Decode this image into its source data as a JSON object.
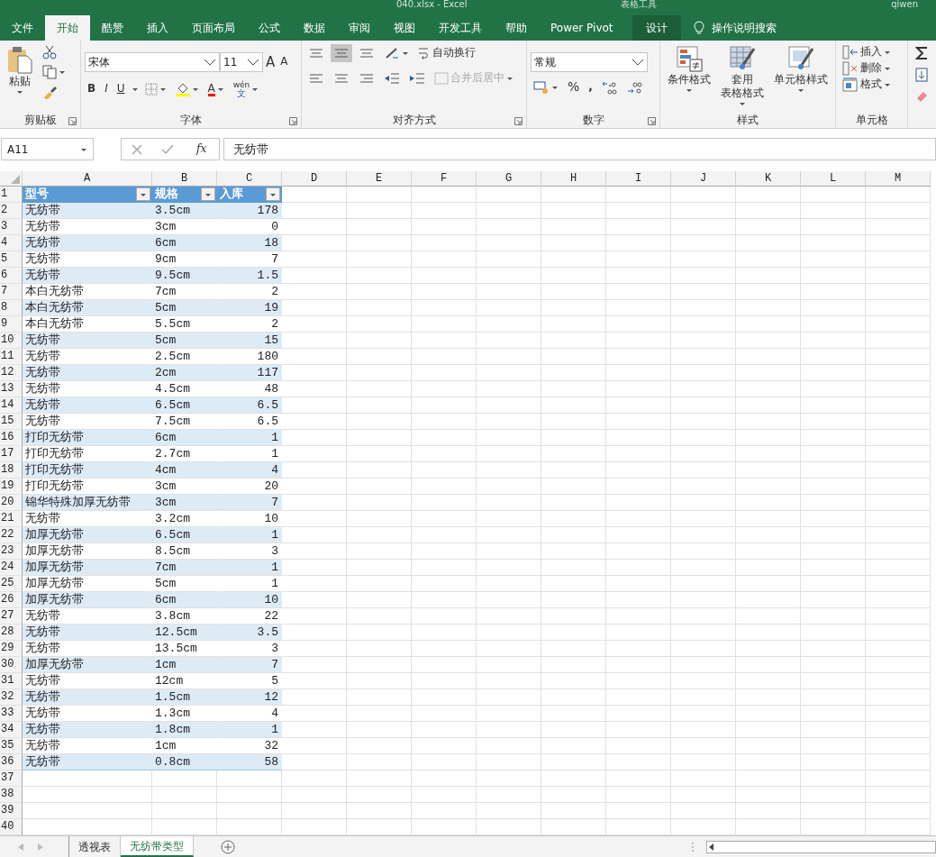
{
  "title_bar": {
    "title": "040.xlsx - Excel",
    "context": "表格工具",
    "user": "qiwen"
  },
  "tabs": [
    {
      "label": "文件",
      "selected": false,
      "kind": "normal"
    },
    {
      "label": "开始",
      "selected": true,
      "kind": "normal"
    },
    {
      "label": "酷赞",
      "selected": false,
      "kind": "normal"
    },
    {
      "label": "插入",
      "selected": false,
      "kind": "normal"
    },
    {
      "label": "页面布局",
      "selected": false,
      "kind": "normal"
    },
    {
      "label": "公式",
      "selected": false,
      "kind": "normal"
    },
    {
      "label": "数据",
      "selected": false,
      "kind": "normal"
    },
    {
      "label": "审阅",
      "selected": false,
      "kind": "normal"
    },
    {
      "label": "视图",
      "selected": false,
      "kind": "normal"
    },
    {
      "label": "开发工具",
      "selected": false,
      "kind": "normal"
    },
    {
      "label": "帮助",
      "selected": false,
      "kind": "normal"
    },
    {
      "label": "Power Pivot",
      "selected": false,
      "kind": "normal"
    },
    {
      "label": "设计",
      "selected": false,
      "kind": "contextual"
    }
  ],
  "tell_me": {
    "label": "操作说明搜索"
  },
  "ribbon": {
    "clipboard": {
      "label": "剪贴板",
      "paste": "粘贴"
    },
    "font": {
      "label": "字体",
      "font_name": "宋体",
      "font_size": "11",
      "grow": "A",
      "shrink": "A",
      "bold": "B",
      "italic": "I",
      "underline": "U",
      "font_color": "A",
      "phonetic_top": "wén",
      "phonetic_bottom": "文"
    },
    "alignment": {
      "label": "对齐方式",
      "wrap_text": "自动换行",
      "merge": "合并后居中",
      "merge_disabled": true
    },
    "number": {
      "label": "数字",
      "format": "常规",
      "percent": "%",
      "comma": ","
    },
    "styles": {
      "label": "样式",
      "conditional": "条件格式",
      "table_top": "套用",
      "table_bottom": "表格格式",
      "cell_styles": "单元格样式"
    },
    "cells": {
      "label": "单元格",
      "insert": "插入",
      "delete": "删除",
      "format": "格式"
    }
  },
  "formula_bar": {
    "name_box": "A11",
    "fx": "fx",
    "formula": "无纺带"
  },
  "sheet": {
    "columns": [
      "A",
      "B",
      "C",
      "D",
      "E",
      "F",
      "G",
      "H",
      "I",
      "J",
      "K",
      "L",
      "M"
    ],
    "row_numbers": [
      "1",
      "2",
      "3",
      "4",
      "5",
      "6",
      "7",
      "8",
      "9",
      "10",
      "11",
      "12",
      "13",
      "14",
      "15",
      "16",
      "17",
      "18",
      "19",
      "20",
      "21",
      "22",
      "23",
      "24",
      "25",
      "26",
      "27",
      "28",
      "29",
      "30",
      "31",
      "32",
      "33",
      "34",
      "35",
      "36",
      "37",
      "38",
      "39",
      "40"
    ],
    "headers": [
      "型号",
      "规格",
      "入库"
    ],
    "rows": [
      [
        "无纺带",
        "3.5cm",
        "178"
      ],
      [
        "无纺带",
        "3cm",
        "0"
      ],
      [
        "无纺带",
        "6cm",
        "18"
      ],
      [
        "无纺带",
        "9cm",
        "7"
      ],
      [
        "无纺带",
        "9.5cm",
        "1.5"
      ],
      [
        "本白无纺带",
        "7cm",
        "2"
      ],
      [
        "本白无纺带",
        "5cm",
        "19"
      ],
      [
        "本白无纺带",
        "5.5cm",
        "2"
      ],
      [
        "无纺带",
        "5cm",
        "15"
      ],
      [
        "无纺带",
        "2.5cm",
        "180"
      ],
      [
        "无纺带",
        "2cm",
        "117"
      ],
      [
        "无纺带",
        "4.5cm",
        "48"
      ],
      [
        "无纺带",
        "6.5cm",
        "6.5"
      ],
      [
        "无纺带",
        "7.5cm",
        "6.5"
      ],
      [
        "打印无纺带",
        "6cm",
        "1"
      ],
      [
        "打印无纺带",
        "2.7cm",
        "1"
      ],
      [
        "打印无纺带",
        "4cm",
        "4"
      ],
      [
        "打印无纺带",
        "3cm",
        "20"
      ],
      [
        "锦华特殊加厚无纺带",
        "3cm",
        "7"
      ],
      [
        "无纺带",
        "3.2cm",
        "10"
      ],
      [
        "加厚无纺带",
        "6.5cm",
        "1"
      ],
      [
        "加厚无纺带",
        "8.5cm",
        "3"
      ],
      [
        "加厚无纺带",
        "7cm",
        "1"
      ],
      [
        "加厚无纺带",
        "5cm",
        "1"
      ],
      [
        "加厚无纺带",
        "6cm",
        "10"
      ],
      [
        "无纺带",
        "3.8cm",
        "22"
      ],
      [
        "无纺带",
        "12.5cm",
        "3.5"
      ],
      [
        "无纺带",
        "13.5cm",
        "3"
      ],
      [
        "加厚无纺带",
        "1cm",
        "7"
      ],
      [
        "无纺带",
        "12cm",
        "5"
      ],
      [
        "无纺带",
        "1.5cm",
        "12"
      ],
      [
        "无纺带",
        "1.3cm",
        "4"
      ],
      [
        "无纺带",
        "1.8cm",
        "1"
      ],
      [
        "无纺带",
        "1cm",
        "32"
      ],
      [
        "无纺带",
        "0.8cm",
        "58"
      ]
    ]
  },
  "sheet_tabs": [
    {
      "label": "透视表",
      "selected": false
    },
    {
      "label": "无纺带类型",
      "selected": true
    }
  ]
}
